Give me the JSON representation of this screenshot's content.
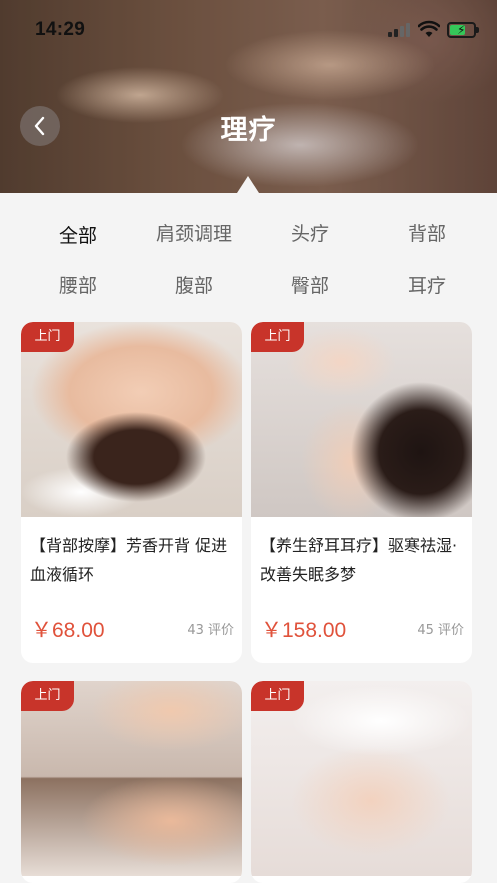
{
  "status_bar": {
    "time": "14:29"
  },
  "header": {
    "title": "理疗"
  },
  "categories": [
    {
      "label": "全部",
      "active": true
    },
    {
      "label": "肩颈调理"
    },
    {
      "label": "头疗"
    },
    {
      "label": "背部"
    },
    {
      "label": "腰部"
    },
    {
      "label": "腹部"
    },
    {
      "label": "臀部"
    },
    {
      "label": "耳疗"
    }
  ],
  "products": [
    {
      "tag": "上门",
      "title": "【背部按摩】芳香开背 促进血液循环",
      "price": "￥68.00",
      "reviews": "43 评价",
      "image": "back-massage-photo"
    },
    {
      "tag": "上门",
      "title": "【养生舒耳耳疗】驱寒祛湿·改善失眠多梦",
      "price": "￥158.00",
      "reviews": "45 评价",
      "image": "ear-therapy-photo"
    },
    {
      "tag": "上门",
      "title": "",
      "price": "",
      "reviews": "",
      "image": "neck-massage-photo"
    },
    {
      "tag": "上门",
      "title": "",
      "price": "",
      "reviews": "",
      "image": "belly-massage-photo"
    }
  ],
  "colors": {
    "accent": "#c8342a",
    "price": "#e0523b",
    "highlight": "#f6c93e"
  }
}
